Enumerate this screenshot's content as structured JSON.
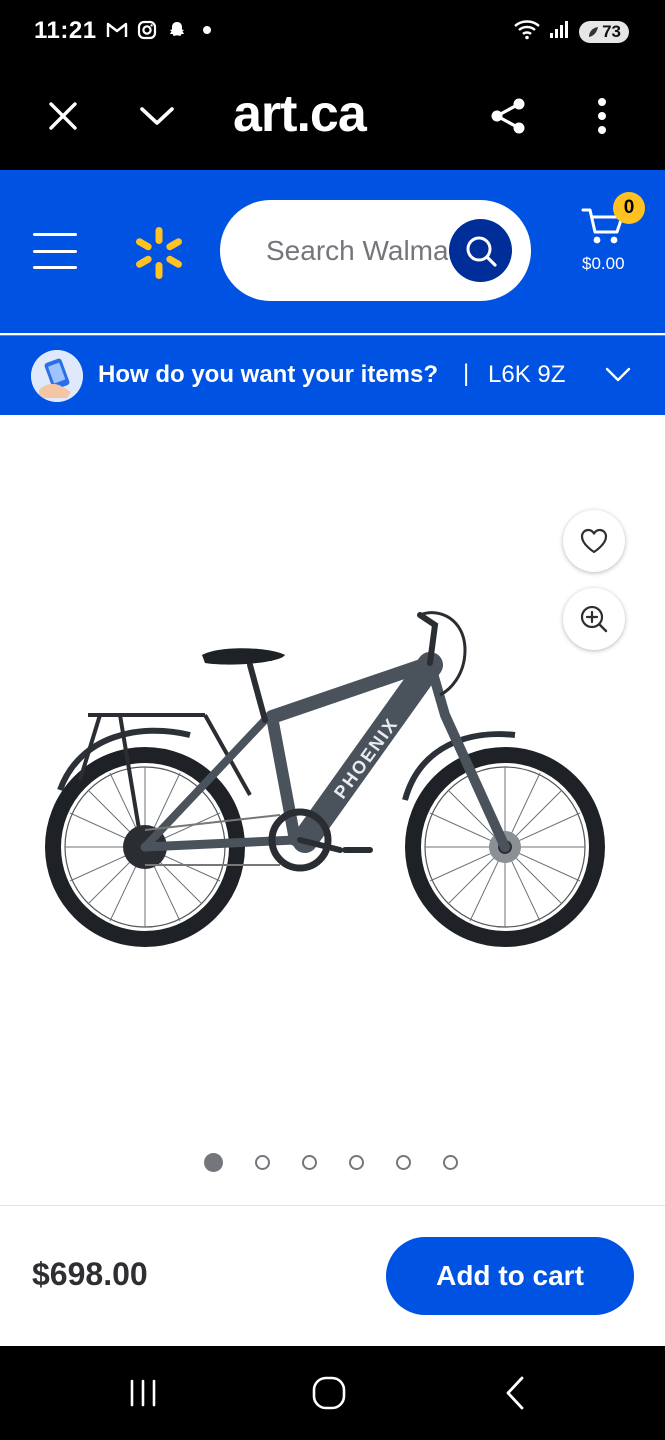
{
  "status_bar": {
    "time": "11:21",
    "battery": "73"
  },
  "browser": {
    "url_text": "art.ca"
  },
  "header": {
    "search_placeholder": "Search Walmart",
    "cart_count": "0",
    "cart_total": "$0.00"
  },
  "fulfillment": {
    "prompt": "How do you want your items?",
    "separator": "|",
    "postal_code": "L6K 9Z"
  },
  "product": {
    "brand_on_frame": "PHOENIX",
    "image_count": 6,
    "active_image_index": 0,
    "price": "$698.00",
    "add_to_cart_label": "Add to cart"
  },
  "colors": {
    "walmart_blue": "#0053e2",
    "search_button_blue": "#002e99",
    "spark_yellow": "#ffc220"
  }
}
